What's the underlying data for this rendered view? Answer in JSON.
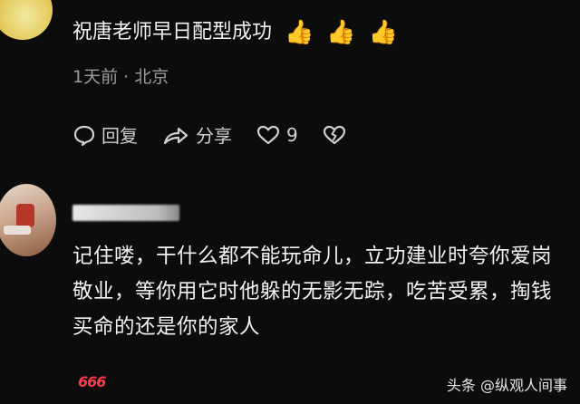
{
  "comment1": {
    "text": "祝唐老师早日配型成功",
    "thumbs": [
      "👍",
      "👍",
      "👍"
    ],
    "time": "1天前",
    "location": "北京",
    "actions": {
      "reply_label": "回复",
      "share_label": "分享",
      "like_count": "9"
    }
  },
  "comment2": {
    "text": "记住喽，干什么都不能玩命儿，立功建业时夸你爱岗敬业，等你用它时他躲的无影无踪，吃苦受累，掏钱买命的还是你的家人",
    "badge": "666"
  },
  "watermark": "头条 @纵观人间事",
  "colors": {
    "background": "#0c0c0d",
    "text": "#f2f2f2",
    "meta": "#9a9a9a",
    "badge": "#ff3b4a"
  }
}
